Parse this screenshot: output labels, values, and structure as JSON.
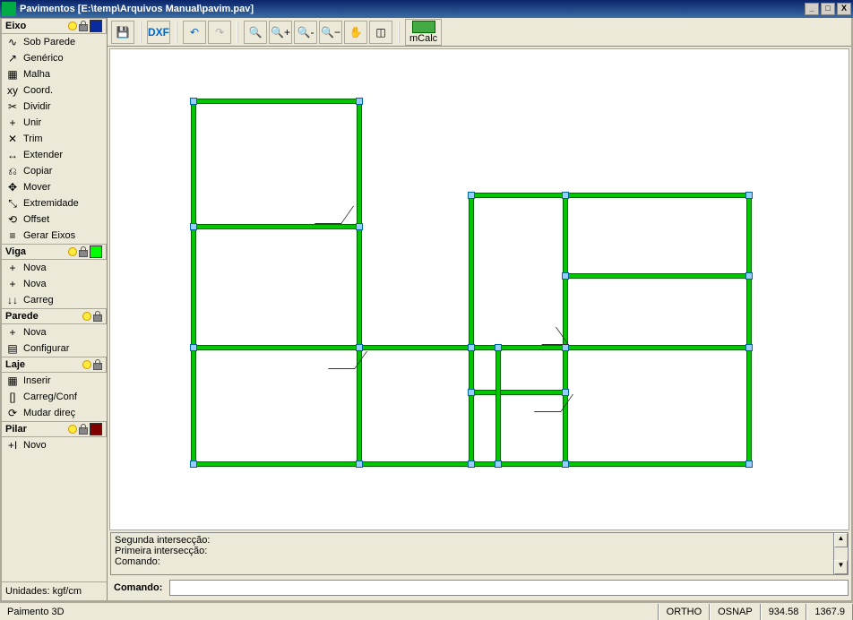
{
  "window": {
    "title": "Pavimentos [E:\\temp\\Arquivos Manual\\pavim.pav]"
  },
  "sidebar": {
    "sections": [
      {
        "title": "Eixo",
        "swatch": "#0a2aa0",
        "items": [
          {
            "icon": "∿",
            "label": "Sob Parede"
          },
          {
            "icon": "↗",
            "label": "Genérico"
          },
          {
            "icon": "▦",
            "label": "Malha"
          },
          {
            "icon": "xy",
            "label": "Coord."
          },
          {
            "icon": "✂",
            "label": "Dividir"
          },
          {
            "icon": "+",
            "label": "Unir"
          },
          {
            "icon": "✕",
            "label": "Trim"
          },
          {
            "icon": "↔",
            "label": "Extender"
          },
          {
            "icon": "⎌",
            "label": "Copiar"
          },
          {
            "icon": "✥",
            "label": "Mover"
          },
          {
            "icon": "⤡",
            "label": "Extremidade"
          },
          {
            "icon": "⟲",
            "label": "Offset"
          },
          {
            "icon": "≡",
            "label": "Gerar Eixos"
          }
        ]
      },
      {
        "title": "Viga",
        "swatch": "#00ff00",
        "items": [
          {
            "icon": "+",
            "label": "Nova"
          },
          {
            "icon": "+",
            "label": "Nova"
          },
          {
            "icon": "↓↓",
            "label": "Carreg"
          }
        ]
      },
      {
        "title": "Parede",
        "swatch": "",
        "items": [
          {
            "icon": "+",
            "label": "Nova"
          },
          {
            "icon": "▤",
            "label": "Configurar"
          }
        ]
      },
      {
        "title": "Laje",
        "swatch": "",
        "items": [
          {
            "icon": "▦",
            "label": "Inserir"
          },
          {
            "icon": "[]",
            "label": "Carreg/Conf"
          },
          {
            "icon": "⟳",
            "label": "Mudar direç"
          }
        ]
      },
      {
        "title": "Pilar",
        "swatch": "#800000",
        "items": [
          {
            "icon": "+I",
            "label": "Novo"
          }
        ]
      }
    ],
    "units": "Unidades: kgf/cm"
  },
  "toolbar": {
    "save": "💾",
    "dxf": "DXF",
    "undo": "↶",
    "redo": "↷",
    "zoom_extents": "🔍",
    "zoom_in": "🔍+",
    "zoom_out": "🔍-",
    "zoom_minus": "🔍−",
    "pan": "✋",
    "erase": "◫",
    "mcalc": "mCalc"
  },
  "log": {
    "line1": "Segunda intersecção:",
    "line2": "Primeira intersecção:",
    "line3": "Comando:"
  },
  "cmd": {
    "label": "Comando:",
    "value": ""
  },
  "status": {
    "left": "Paimento 3D",
    "ortho": "ORTHO",
    "osnap": "OSNAP",
    "x": "934.58",
    "y": "1367.9"
  }
}
